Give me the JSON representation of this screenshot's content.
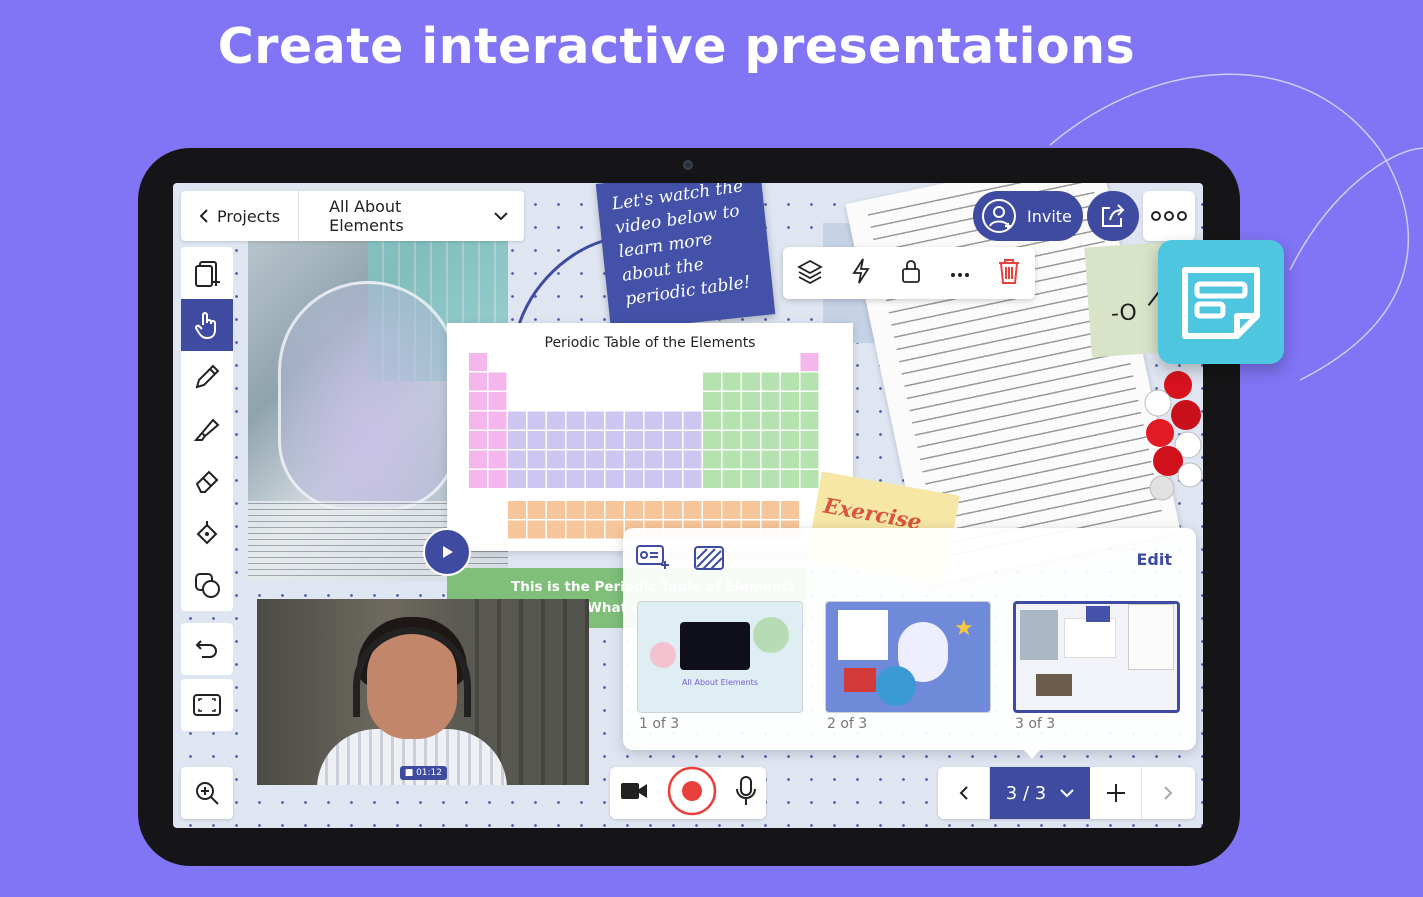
{
  "headline": "Create interactive presentations",
  "topbar": {
    "back_label": "Projects",
    "project_name": "All About Elements"
  },
  "note_text": "Let's watch the\nvideo below to\nlearn more\nabout the\nperiodic table!",
  "periodic_card": {
    "title": "Periodic Table of the Elements"
  },
  "exercise_label": "Exercise",
  "caption": {
    "line1": "This is the Periodic Table of Elements",
    "line2": "What do you notice?"
  },
  "video": {
    "duration": "01:12"
  },
  "header_buttons": {
    "invite_label": "Invite"
  },
  "slides_panel": {
    "edit_label": "Edit",
    "thumbnails": [
      {
        "label": "1 of 3",
        "title": "All About Elements"
      },
      {
        "label": "2 of 3"
      },
      {
        "label": "3 of 3"
      }
    ]
  },
  "pager": {
    "count": "3 / 3"
  },
  "colors": {
    "brand": "#3e4ba0",
    "background": "#8174f5",
    "record": "#e8413d",
    "app_icon": "#4fc6e0"
  }
}
